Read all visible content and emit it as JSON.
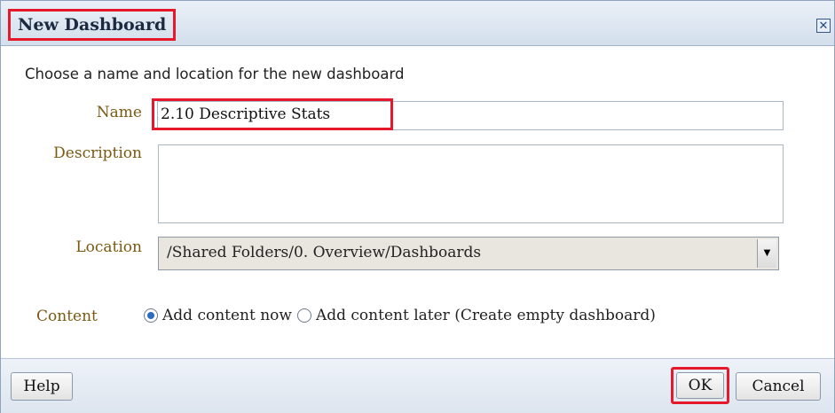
{
  "dialog": {
    "title": "New Dashboard",
    "close_icon": "close-icon"
  },
  "form": {
    "instruction": "Choose a name and location for the new dashboard",
    "name_label": "Name",
    "name_value": "2.10 Descriptive Stats",
    "description_label": "Description",
    "description_value": "",
    "location_label": "Location",
    "location_value": "/Shared Folders/0. Overview/Dashboards",
    "content_label": "Content",
    "content_options": [
      {
        "label": "Add content now",
        "selected": true
      },
      {
        "label": "Add content later (Create empty dashboard)",
        "selected": false
      }
    ]
  },
  "footer": {
    "help_label": "Help",
    "ok_label": "OK",
    "cancel_label": "Cancel"
  },
  "colors": {
    "highlight": "#e5192b",
    "label_text": "#7a5a12",
    "title_bar": "#d3dfec"
  }
}
